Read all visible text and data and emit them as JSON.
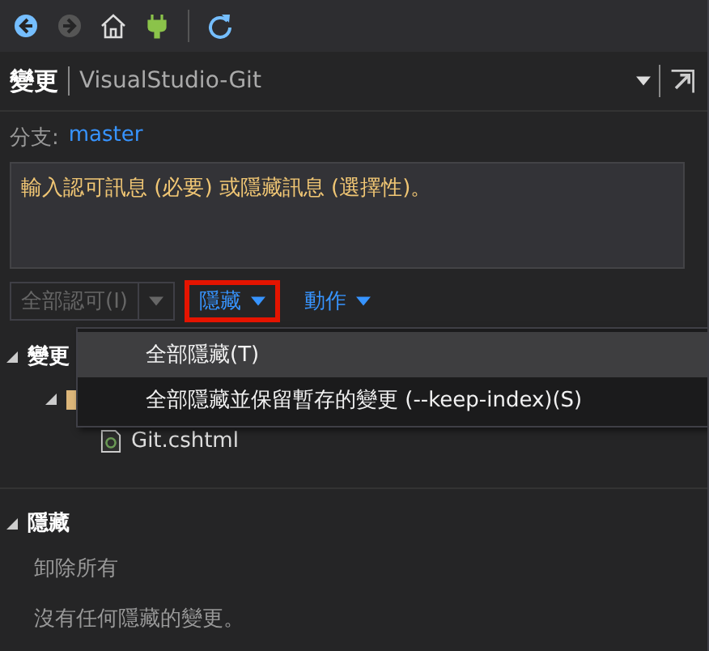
{
  "toolbar": {
    "buttons": [
      {
        "kind": "back",
        "disabled": false
      },
      {
        "kind": "forward",
        "disabled": true
      },
      {
        "kind": "home",
        "disabled": false
      },
      {
        "kind": "plug",
        "disabled": false
      },
      {
        "kind": "refresh",
        "disabled": false
      }
    ]
  },
  "header": {
    "title": "變更",
    "repo": "VisualStudio-Git"
  },
  "branch": {
    "label": "分支:",
    "name": "master"
  },
  "commit_message": {
    "placeholder": "輸入認可訊息 (必要) 或隱藏訊息 (選擇性)。"
  },
  "actions": [
    {
      "kind": "split",
      "label": "全部認可(I)",
      "disabled": true,
      "highlighted": false
    },
    {
      "kind": "menu",
      "label": "隱藏",
      "disabled": false,
      "highlighted": true
    },
    {
      "kind": "menu",
      "label": "動作",
      "disabled": false,
      "highlighted": false
    }
  ],
  "stash_menu": {
    "items": [
      {
        "label": "全部隱藏(T)",
        "selected": true
      },
      {
        "label": "全部隱藏並保留暫存的變更 (--keep-index)(S)",
        "selected": false
      }
    ]
  },
  "changes": {
    "title": "變更",
    "expanded": true,
    "children": [
      {
        "kind": "folder",
        "expanded": true,
        "children": [
          {
            "kind": "file",
            "label": "Git.cshtml"
          }
        ]
      }
    ]
  },
  "stashes": {
    "title": "隱藏",
    "expanded": true,
    "link": "卸除所有",
    "message": "沒有任何隱藏的變更。"
  }
}
